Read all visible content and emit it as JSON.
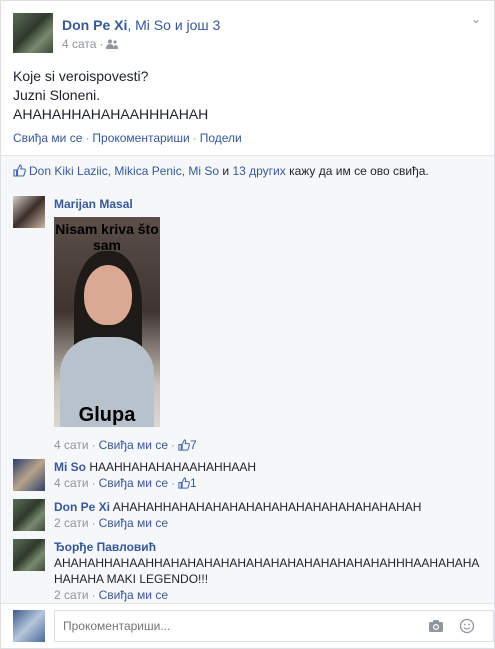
{
  "post": {
    "author": "Don Pe Xi",
    "tagged": ", Mi So и још 3",
    "time": "4 сата",
    "lines": [
      "Koje si veroispovesti?",
      "Juzni Sloneni.",
      "AHAHAHHAHAHAAHHHAHAH"
    ],
    "actions": {
      "like": "Свиђа ми се",
      "comment": "Прокоментариши",
      "share": "Подели"
    }
  },
  "likes": {
    "names": "Don Kiki Laziic, Mikica Penic, Mi So",
    "and": " и ",
    "others": "13 других",
    "suffix": " кажу да им се ово свиђа."
  },
  "comments": [
    {
      "author": "Marijan Masal",
      "text": "",
      "meme_top": "Nisam kriva što sam",
      "meme_bottom": "Glupa",
      "time": "4 сати",
      "like": "Свиђа ми се",
      "count": "7"
    },
    {
      "author": "Mi So",
      "text": "HAAHHAHAHAHAAHAHHAAH",
      "time": "4 сати",
      "like": "Свиђа ми се",
      "count": "1"
    },
    {
      "author": "Don Pe Xi",
      "text": "AHAHAHHAHAHAHAHAHAHAHAHAHAHAHAHAHAHAH",
      "time": "2 сати",
      "like": "Свиђа ми се"
    },
    {
      "author": "Ђорђе Павловић",
      "text": "AHAHAHHAHAAHHAHAHAHAHAHAHAHAHAHAHAHAHAHAHHHAAHAHAHAHAHAHA MAKI LEGENDO!!!",
      "time": "2 сати",
      "like": "Свиђа ми се"
    }
  ],
  "reply": {
    "placeholder": "Прокоментариши..."
  },
  "icons": {
    "chevron": "chevron-down-icon",
    "audience": "friends-icon",
    "like": "thumbs-up-icon",
    "camera": "camera-icon",
    "emoji": "emoji-icon"
  },
  "colors": {
    "link": "#365899",
    "meta": "#90949c",
    "panel": "#f6f7f9"
  }
}
